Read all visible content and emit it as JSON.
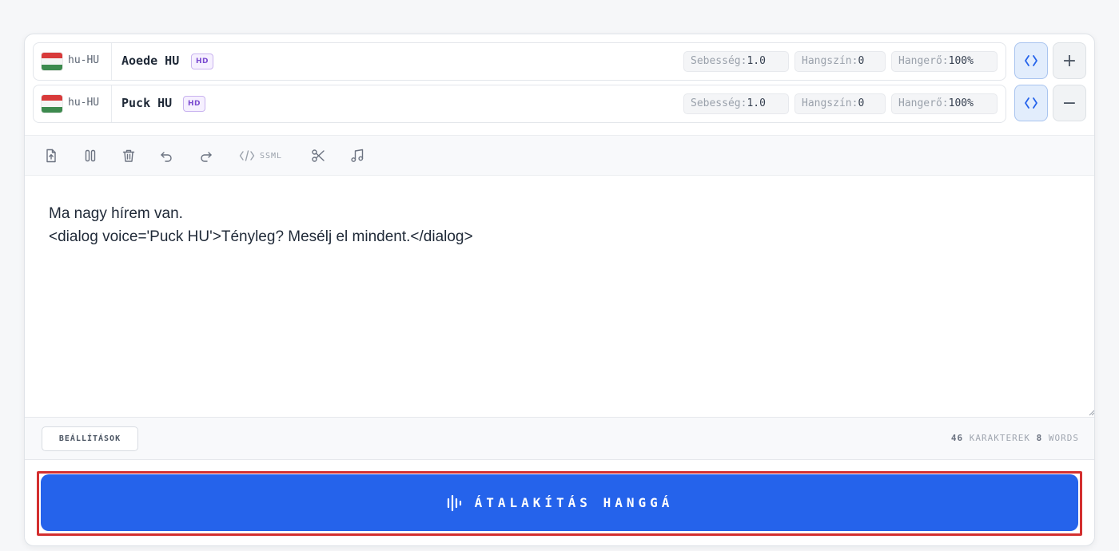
{
  "voices": [
    {
      "locale": "hu-HU",
      "name": "Aoede HU",
      "badge": "HD",
      "speed_label": "Sebesség:",
      "speed_value": "1.0",
      "pitch_label": "Hangszín:",
      "pitch_value": "0",
      "volume_label": "Hangerő:",
      "volume_value": "100%",
      "action": "+"
    },
    {
      "locale": "hu-HU",
      "name": "Puck HU",
      "badge": "HD",
      "speed_label": "Sebesség:",
      "speed_value": "1.0",
      "pitch_label": "Hangszín:",
      "pitch_value": "0",
      "volume_label": "Hangerő:",
      "volume_value": "100%",
      "action": "−"
    }
  ],
  "toolbar": {
    "icons": [
      "upload-icon",
      "pause-icon",
      "trash-icon",
      "undo-icon",
      "redo-icon",
      "code-icon",
      "scissors-icon",
      "music-note-icon"
    ],
    "ssml_label": "SSML"
  },
  "editor": {
    "lines": [
      "Ma nagy hírem van.",
      "<dialog voice='Puck HU'>Tényleg? Mesélj el mindent.</dialog>"
    ]
  },
  "footer": {
    "settings_label": "BEÁLLÍTÁSOK",
    "char_count": "46",
    "char_label": "KARAKTEREK",
    "word_count": "8",
    "word_label": "WORDS"
  },
  "convert": {
    "label": "ÁTALAKÍTÁS HANGGÁ",
    "icon": "audio-wave-icon"
  },
  "colors": {
    "accent": "#2563eb",
    "highlight_frame": "#d32f2f",
    "hd_badge": "#7b4bd0"
  }
}
